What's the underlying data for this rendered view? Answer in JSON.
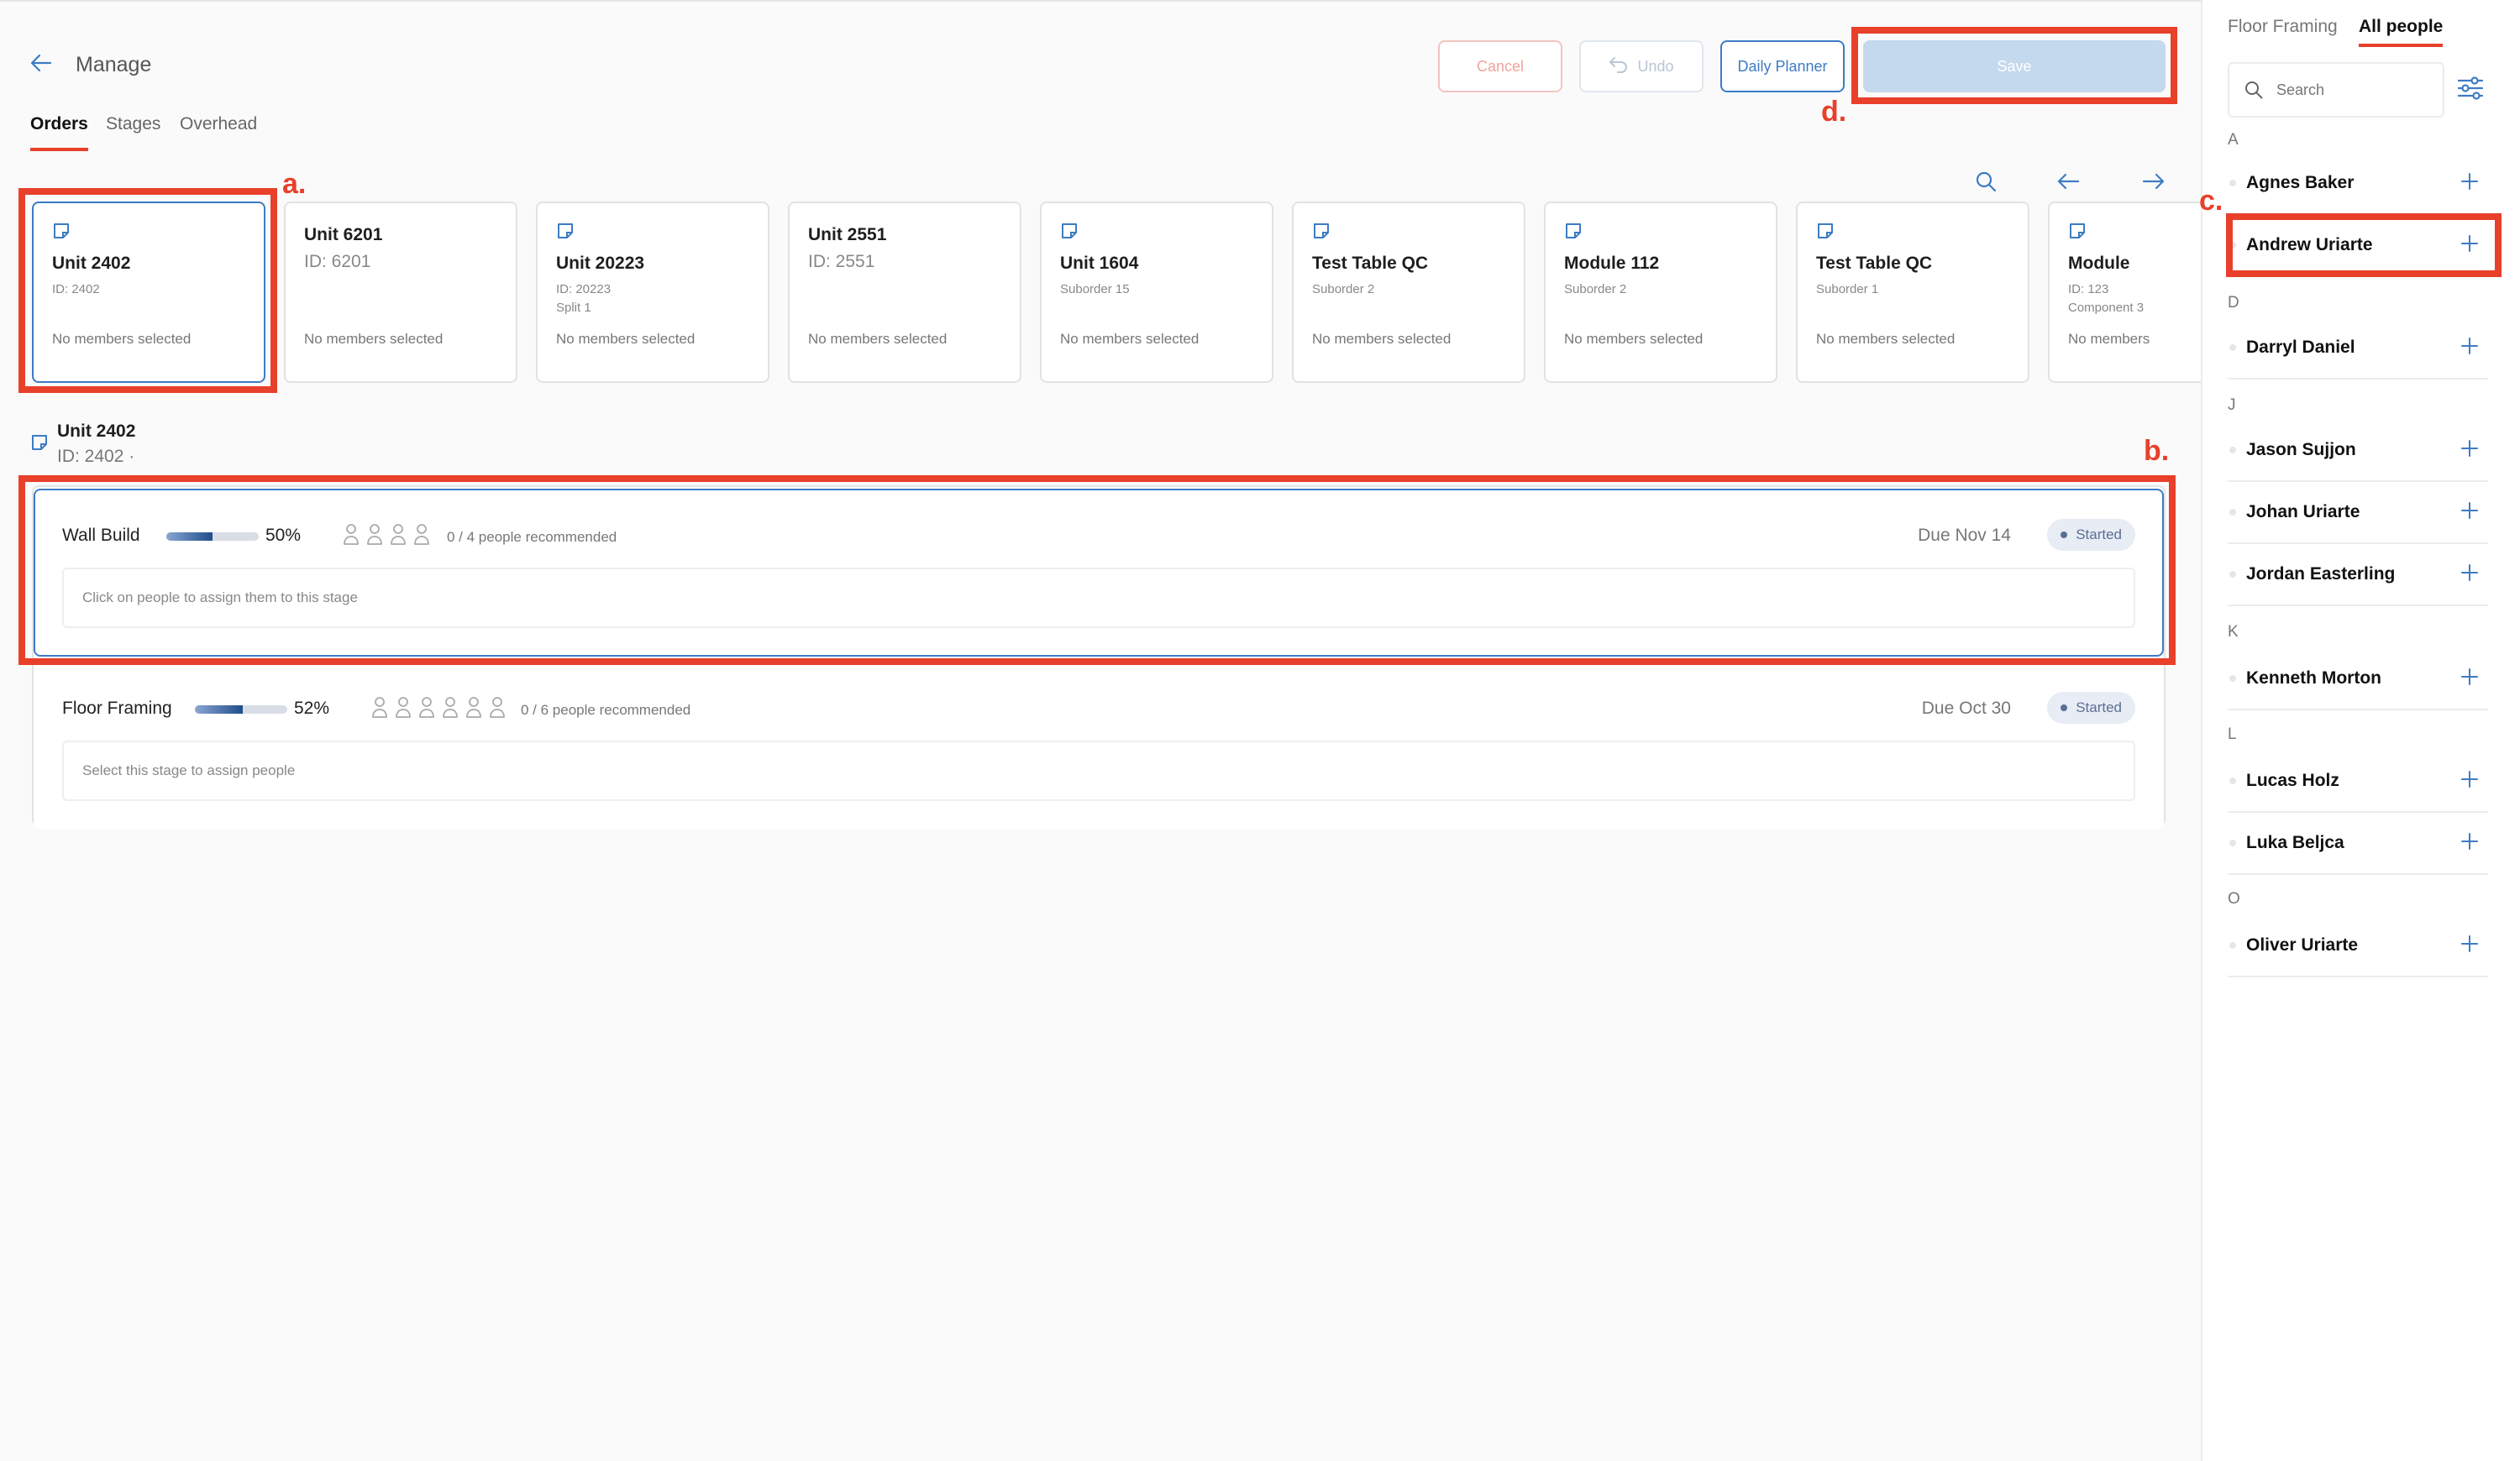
{
  "header": {
    "back_label": "Manage"
  },
  "tabs": [
    {
      "label": "Orders",
      "active": true
    },
    {
      "label": "Stages",
      "active": false
    },
    {
      "label": "Overhead",
      "active": false
    }
  ],
  "toolbar": {
    "cancel_label": "Cancel",
    "undo_label": "Undo",
    "planner_label": "Daily Planner",
    "save_label": "Save"
  },
  "annotations": {
    "a": "a.",
    "b": "b.",
    "c": "c.",
    "d": "d."
  },
  "orders": [
    {
      "title": "Unit 2402",
      "sub1": "ID: 2402",
      "sub2": "",
      "members": "No members selected",
      "icon": true,
      "selected": true
    },
    {
      "title": "Unit 6201",
      "sub1": "ID: 6201",
      "sub2": "",
      "members": "No members selected",
      "icon": false,
      "selected": false
    },
    {
      "title": "Unit 20223",
      "sub1": "ID: 20223",
      "sub2": "Split 1",
      "members": "No members selected",
      "icon": true,
      "selected": false
    },
    {
      "title": "Unit 2551",
      "sub1": "ID: 2551",
      "sub2": "",
      "members": "No members selected",
      "icon": false,
      "selected": false
    },
    {
      "title": "Unit 1604",
      "sub1": "Suborder 15",
      "sub2": "",
      "members": "No members selected",
      "icon": true,
      "selected": false
    },
    {
      "title": "Test Table QC",
      "sub1": "Suborder 2",
      "sub2": "",
      "members": "No members selected",
      "icon": true,
      "selected": false
    },
    {
      "title": "Module 112",
      "sub1": "Suborder 2",
      "sub2": "",
      "members": "No members selected",
      "icon": true,
      "selected": false
    },
    {
      "title": "Test Table QC",
      "sub1": "Suborder 1",
      "sub2": "",
      "members": "No members selected",
      "icon": true,
      "selected": false
    },
    {
      "title": "Module",
      "sub1": "ID: 123",
      "sub2": "Component 3",
      "members": "No members",
      "icon": true,
      "selected": false
    }
  ],
  "selected_order": {
    "title": "Unit 2402",
    "id": "ID: 2402 ·"
  },
  "stages": [
    {
      "name": "Wall Build",
      "progress_pct": "50%",
      "progress": 0.5,
      "people_icons": 4,
      "recommended": "0 / 4 people recommended",
      "due": "Due Nov 14",
      "status": "Started",
      "hint": "Click on people to assign them to this stage"
    },
    {
      "name": "Floor Framing",
      "progress_pct": "52%",
      "progress": 0.52,
      "people_icons": 6,
      "recommended": "0 / 6 people recommended",
      "due": "Due Oct 30",
      "status": "Started",
      "hint": "Select this stage to assign people"
    }
  ],
  "sidebar": {
    "tabs": [
      {
        "label": "Floor Framing",
        "active": false
      },
      {
        "label": "All people",
        "active": true
      }
    ],
    "search_placeholder": "Search",
    "sections": [
      {
        "letter": "A",
        "people": [
          "Agnes Baker",
          "Andrew Uriarte"
        ]
      },
      {
        "letter": "D",
        "people": [
          "Darryl Daniel"
        ]
      },
      {
        "letter": "J",
        "people": [
          "Jason Sujjon",
          "Johan Uriarte",
          "Jordan Easterling"
        ]
      },
      {
        "letter": "K",
        "people": [
          "Kenneth Morton"
        ]
      },
      {
        "letter": "L",
        "people": [
          "Lucas Holz",
          "Luka Beljca"
        ]
      },
      {
        "letter": "O",
        "people": [
          "Oliver Uriarte"
        ]
      }
    ]
  },
  "colors": {
    "accent": "#e8402a",
    "primary": "#3d7bc4",
    "save_disabled": "#c4d8ee",
    "tab_underline": "#e8402a"
  },
  "icons": [
    "back-arrow-icon",
    "undo-icon",
    "search-icon",
    "arrow-left-icon",
    "arrow-right-icon",
    "order-icon",
    "person-icon",
    "plus-icon",
    "filter-icon"
  ]
}
